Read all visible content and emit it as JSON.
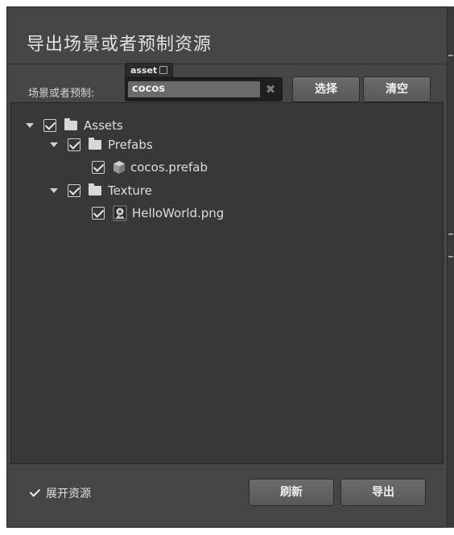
{
  "dialog": {
    "title": "导出场景或者预制资源"
  },
  "source": {
    "label": "场景或者预制:",
    "asset_tag": "asset",
    "asset_value": "cocos",
    "clear_symbol": "✖",
    "select_button": "选择",
    "clear_button": "清空"
  },
  "tree": {
    "items": [
      {
        "label": "Assets",
        "icon": "folder-icon",
        "depth": 0,
        "expanded": true,
        "checked": true
      },
      {
        "label": "Prefabs",
        "icon": "folder-icon",
        "depth": 1,
        "expanded": true,
        "checked": true
      },
      {
        "label": "cocos.prefab",
        "icon": "prefab-icon",
        "depth": 2,
        "expanded": false,
        "checked": true
      },
      {
        "label": "Texture",
        "icon": "folder-icon",
        "depth": 1,
        "expanded": true,
        "checked": true
      },
      {
        "label": "HelloWorld.png",
        "icon": "image-file-icon",
        "depth": 2,
        "expanded": false,
        "checked": true
      }
    ]
  },
  "footer": {
    "expand_label": "展开资源",
    "expand_checked": true,
    "refresh_button": "刷新",
    "export_button": "导出"
  }
}
